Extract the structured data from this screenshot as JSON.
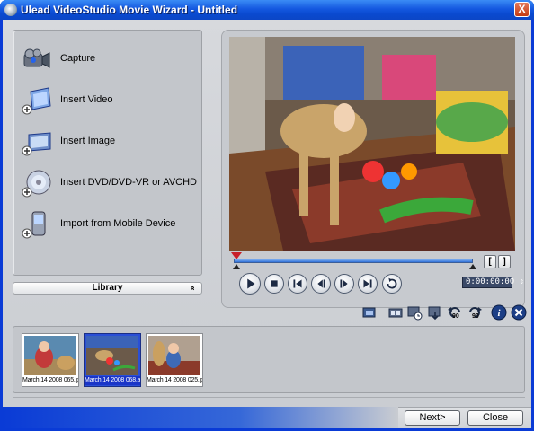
{
  "window": {
    "title": "Ulead VideoStudio Movie Wizard - Untitled",
    "close_glyph": "X"
  },
  "options": [
    {
      "label": "Capture",
      "icon": "camcorder-icon"
    },
    {
      "label": "Insert Video",
      "icon": "insert-video-icon"
    },
    {
      "label": "Insert Image",
      "icon": "insert-image-icon"
    },
    {
      "label": "Insert DVD/DVD-VR or AVCHD",
      "icon": "insert-dvd-icon"
    },
    {
      "label": "Import from Mobile Device",
      "icon": "mobile-device-icon"
    }
  ],
  "library": {
    "label": "Library",
    "toggle_glyph": "»"
  },
  "preview": {
    "timecode": "0:00:00:00",
    "trim_in_glyph": "[",
    "trim_out_glyph": "]",
    "scrub_position": 0.0
  },
  "playback_controls": [
    "play-icon",
    "stop-icon",
    "home-icon",
    "previous-frame-icon",
    "next-frame-icon",
    "end-icon",
    "repeat-icon"
  ],
  "toolbar": {
    "rotate_left_label": "90",
    "rotate_right_label": "90",
    "icons": [
      "export-icon",
      "storyboard-icon",
      "timeline-icon",
      "sort-icon",
      "rotate-left-icon",
      "rotate-right-icon",
      "info-icon",
      "delete-icon"
    ]
  },
  "thumbnails": [
    {
      "caption": "March 14 2008 065.jpg",
      "selected": false
    },
    {
      "caption": "March 14 2008 068.avi",
      "selected": true
    },
    {
      "caption": "March 14 2008 025.jpg",
      "selected": false
    }
  ],
  "buttons": {
    "next": "Next>",
    "close": "Close"
  },
  "colors": {
    "title_bar": "#0b46c6",
    "selection": "#1a35c8",
    "scrub_bar": "#2e6fd8",
    "scrub_handle": "#c8202a"
  }
}
